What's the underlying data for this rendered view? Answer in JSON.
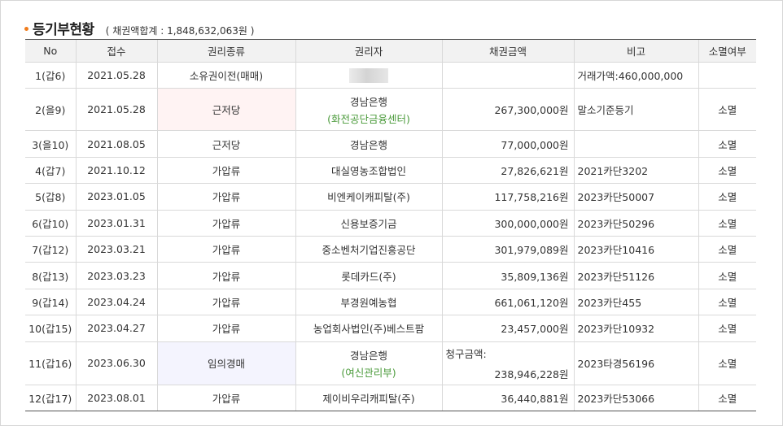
{
  "header": {
    "title": "등기부현황",
    "subtitle": "( 채권액합계 : 1,848,632,063원 )"
  },
  "columns": [
    "No",
    "접수",
    "권리종류",
    "권리자",
    "채권금액",
    "비고",
    "소멸여부"
  ],
  "rows": [
    {
      "no": "1(갑6)",
      "date": "2021.05.28",
      "type": "소유권이전(매매)",
      "holder": "",
      "holder_sub": "",
      "amount_label": "",
      "amount": "",
      "note": "거래가액:460,000,000",
      "extinct": ""
    },
    {
      "no": "2(을9)",
      "date": "2021.05.28",
      "type": "근저당",
      "holder": "경남은행",
      "holder_sub": "(화전공단금융센터)",
      "amount_label": "",
      "amount": "267,300,000원",
      "note": "말소기준등기",
      "extinct": "소멸"
    },
    {
      "no": "3(을10)",
      "date": "2021.08.05",
      "type": "근저당",
      "holder": "경남은행",
      "holder_sub": "",
      "amount_label": "",
      "amount": "77,000,000원",
      "note": "",
      "extinct": "소멸"
    },
    {
      "no": "4(갑7)",
      "date": "2021.10.12",
      "type": "가압류",
      "holder": "대실영농조합법인",
      "holder_sub": "",
      "amount_label": "",
      "amount": "27,826,621원",
      "note": "2021카단3202",
      "extinct": "소멸"
    },
    {
      "no": "5(갑8)",
      "date": "2023.01.05",
      "type": "가압류",
      "holder": "비엔케이캐피탈(주)",
      "holder_sub": "",
      "amount_label": "",
      "amount": "117,758,216원",
      "note": "2023카단50007",
      "extinct": "소멸"
    },
    {
      "no": "6(갑10)",
      "date": "2023.01.31",
      "type": "가압류",
      "holder": "신용보증기금",
      "holder_sub": "",
      "amount_label": "",
      "amount": "300,000,000원",
      "note": "2023카단50296",
      "extinct": "소멸"
    },
    {
      "no": "7(갑12)",
      "date": "2023.03.21",
      "type": "가압류",
      "holder": "중소벤처기업진흥공단",
      "holder_sub": "",
      "amount_label": "",
      "amount": "301,979,089원",
      "note": "2023카단10416",
      "extinct": "소멸"
    },
    {
      "no": "8(갑13)",
      "date": "2023.03.23",
      "type": "가압류",
      "holder": "롯데카드(주)",
      "holder_sub": "",
      "amount_label": "",
      "amount": "35,809,136원",
      "note": "2023카단51126",
      "extinct": "소멸"
    },
    {
      "no": "9(갑14)",
      "date": "2023.04.24",
      "type": "가압류",
      "holder": "부경원예농협",
      "holder_sub": "",
      "amount_label": "",
      "amount": "661,061,120원",
      "note": "2023카단455",
      "extinct": "소멸"
    },
    {
      "no": "10(갑15)",
      "date": "2023.04.27",
      "type": "가압류",
      "holder": "농업회사법인(주)베스트팜",
      "holder_sub": "",
      "amount_label": "",
      "amount": "23,457,000원",
      "note": "2023카단10932",
      "extinct": "소멸"
    },
    {
      "no": "11(갑16)",
      "date": "2023.06.30",
      "type": "임의경매",
      "holder": "경남은행",
      "holder_sub": "(여신관리부)",
      "amount_label": "청구금액:",
      "amount": "238,946,228원",
      "note": "2023타경56196",
      "extinct": "소멸"
    },
    {
      "no": "12(갑17)",
      "date": "2023.08.01",
      "type": "가압류",
      "holder": "제이비우리캐피탈(주)",
      "holder_sub": "",
      "amount_label": "",
      "amount": "36,440,881원",
      "note": "2023카단53066",
      "extinct": "소멸"
    }
  ],
  "colors": {
    "accent_bullet": "#f07c1c",
    "holder_sub_text": "#4a9a3a",
    "highlight_pink": "#fff3f3",
    "highlight_lavender": "#f4f4fe",
    "header_bg": "#f2f2f2"
  }
}
